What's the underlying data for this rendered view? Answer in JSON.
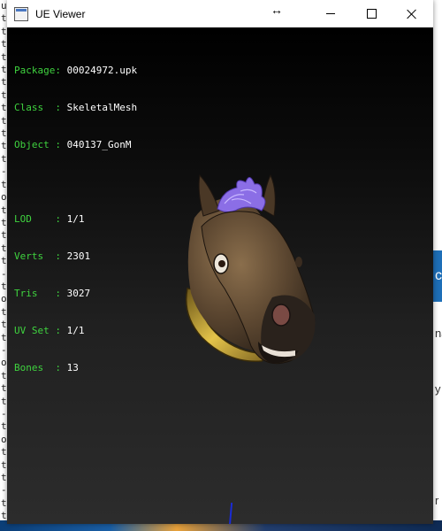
{
  "window": {
    "title": "UE Viewer",
    "resize_glyph": "↔",
    "controls": {
      "minimize": "minimize",
      "maximize": "maximize",
      "close": "close"
    }
  },
  "mesh_info": {
    "package": {
      "label": "Package:",
      "value": "00024972.upk"
    },
    "class": {
      "label": "Class  :",
      "value": "SkeletalMesh"
    },
    "object": {
      "label": "Object :",
      "value": "040137_GonM"
    },
    "lod": {
      "label": "LOD    :",
      "value": "1/1"
    },
    "verts": {
      "label": "Verts  :",
      "value": "2301"
    },
    "tris": {
      "label": "Tris   :",
      "value": "3027"
    },
    "uvset": {
      "label": "UV Set :",
      "value": "1/1"
    },
    "bones": {
      "label": "Bones  :",
      "value": "13"
    }
  },
  "background": {
    "left_chars": [
      "u",
      "t",
      "t",
      "t",
      "t",
      "t",
      "t",
      "t",
      "t",
      "t",
      "t",
      "t",
      "t",
      "-",
      "t",
      "o",
      "t",
      "t",
      "t",
      "t",
      "t",
      "-",
      "t",
      "o",
      "t",
      "t",
      "t",
      "-",
      "o",
      "t",
      "t",
      "t",
      "-",
      "t",
      "o",
      "t",
      "t",
      "t",
      "-",
      "t",
      "t"
    ],
    "right_text": [
      {
        "text": "c"
      },
      {
        "text": "na"
      },
      {
        "text": "y"
      },
      {
        "text": "r"
      }
    ]
  },
  "colors": {
    "label_green": "#3fd33f",
    "value_white": "#ffffff",
    "viewport_bg": "#000000"
  }
}
